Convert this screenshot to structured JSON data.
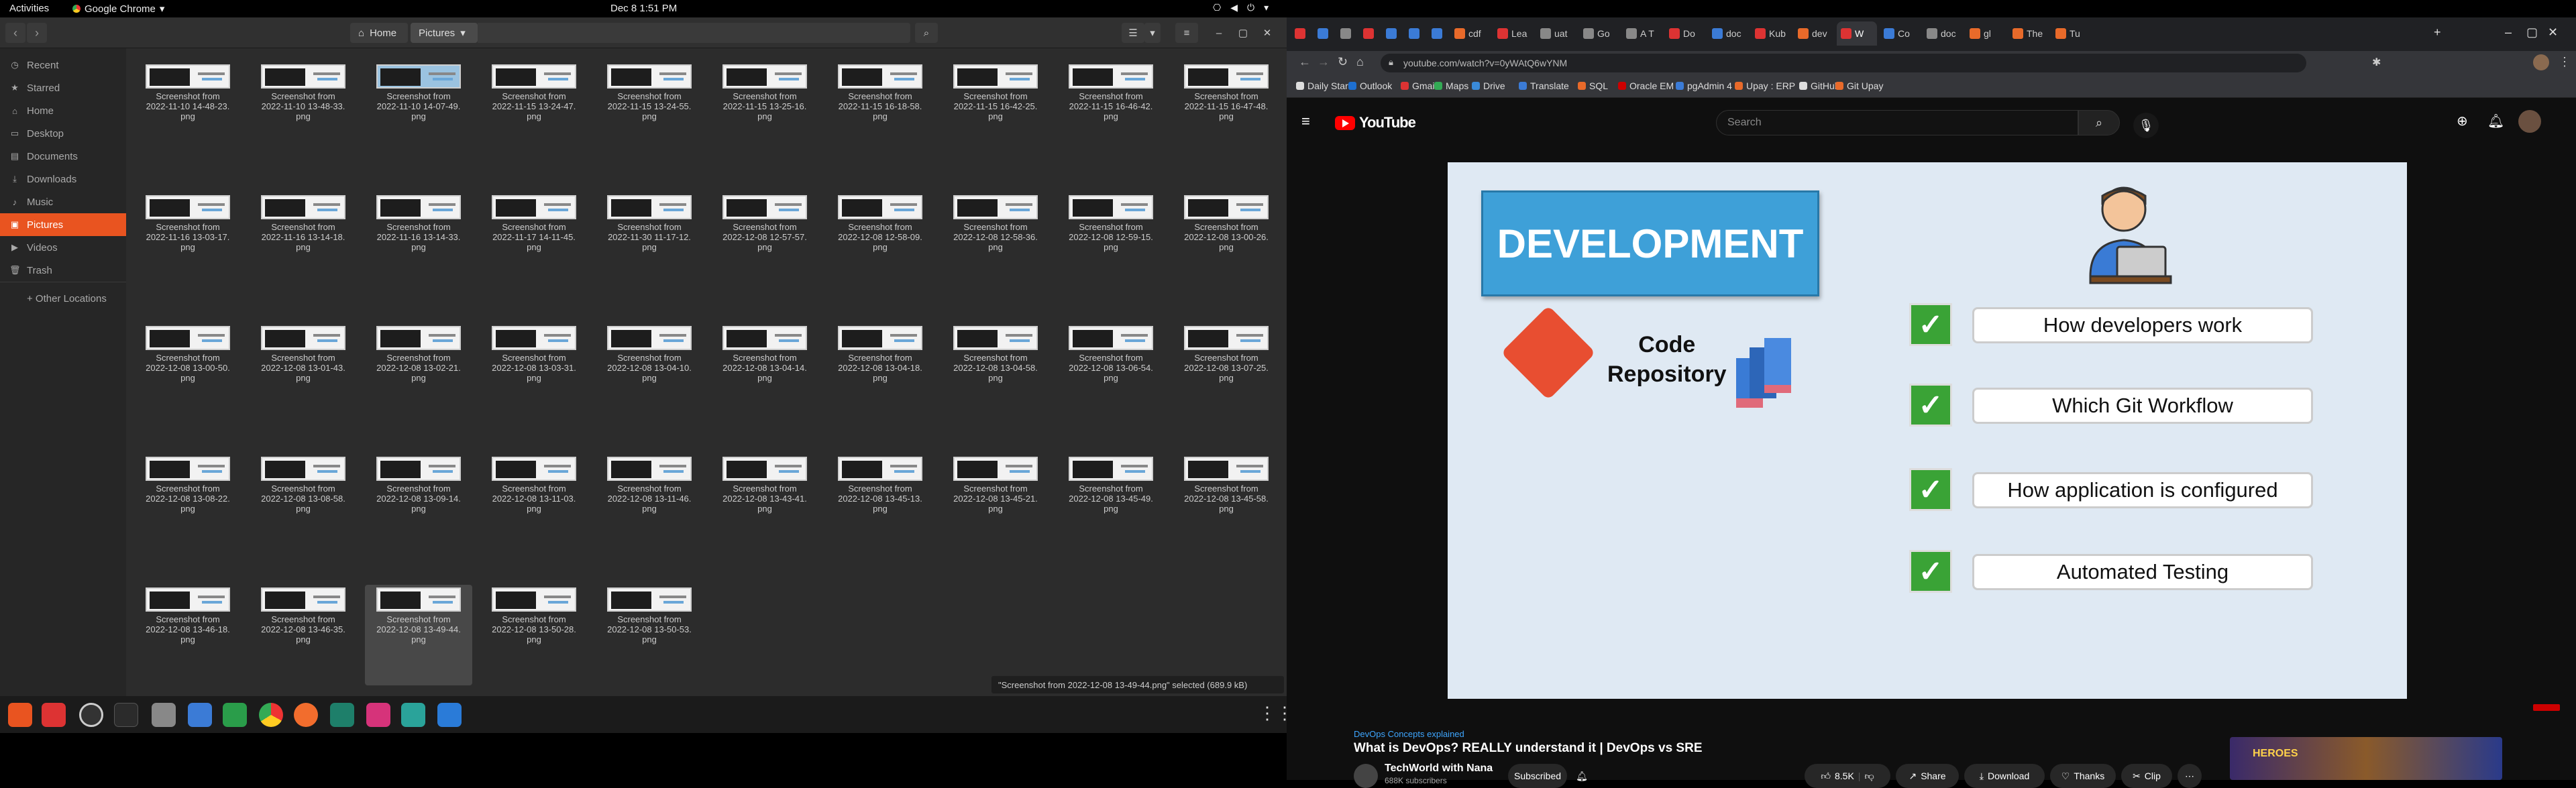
{
  "topbar": {
    "activities": "Activities",
    "app": "Google Chrome",
    "clock": "Dec 8  1:51 PM"
  },
  "files": {
    "crumbs": [
      "Home",
      "Pictures"
    ],
    "sidebar": [
      {
        "label": "Recent",
        "icon": "clock-icon"
      },
      {
        "label": "Starred",
        "icon": "star-icon"
      },
      {
        "label": "Home",
        "icon": "home-icon"
      },
      {
        "label": "Desktop",
        "icon": "desktop-icon"
      },
      {
        "label": "Documents",
        "icon": "documents-icon"
      },
      {
        "label": "Downloads",
        "icon": "downloads-icon"
      },
      {
        "label": "Music",
        "icon": "music-icon"
      },
      {
        "label": "Pictures",
        "icon": "pictures-icon"
      },
      {
        "label": "Videos",
        "icon": "videos-icon"
      },
      {
        "label": "Trash",
        "icon": "trash-icon"
      },
      {
        "label": "+ Other Locations",
        "icon": "plus-icon"
      }
    ],
    "items": [
      [
        "Screenshot from",
        "2022-11-10 14-48-23.",
        "png"
      ],
      [
        "Screenshot from",
        "2022-11-10 13-48-33.",
        "png"
      ],
      [
        "Screenshot from",
        "2022-11-10 14-07-49.",
        "png"
      ],
      [
        "Screenshot from",
        "2022-11-15 13-24-47.",
        "png"
      ],
      [
        "Screenshot from",
        "2022-11-15 13-24-55.",
        "png"
      ],
      [
        "Screenshot from",
        "2022-11-15 13-25-16.",
        "png"
      ],
      [
        "Screenshot from",
        "2022-11-15 16-18-58.",
        "png"
      ],
      [
        "Screenshot from",
        "2022-11-15 16-42-25.",
        "png"
      ],
      [
        "Screenshot from",
        "2022-11-15 16-46-42.",
        "png"
      ],
      [
        "Screenshot from",
        "2022-11-15 16-47-48.",
        "png"
      ],
      [
        "Screenshot from",
        "2022-11-16 13-03-17.",
        "png"
      ],
      [
        "Screenshot from",
        "2022-11-16 13-14-18.",
        "png"
      ],
      [
        "Screenshot from",
        "2022-11-16 13-14-33.",
        "png"
      ],
      [
        "Screenshot from",
        "2022-11-17 14-11-45.",
        "png"
      ],
      [
        "Screenshot from",
        "2022-11-30 11-17-12.",
        "png"
      ],
      [
        "Screenshot from",
        "2022-12-08 12-57-57.",
        "png"
      ],
      [
        "Screenshot from",
        "2022-12-08 12-58-09.",
        "png"
      ],
      [
        "Screenshot from",
        "2022-12-08 12-58-36.",
        "png"
      ],
      [
        "Screenshot from",
        "2022-12-08 12-59-15.",
        "png"
      ],
      [
        "Screenshot from",
        "2022-12-08 13-00-26.",
        "png"
      ],
      [
        "Screenshot from",
        "2022-12-08 13-00-50.",
        "png"
      ],
      [
        "Screenshot from",
        "2022-12-08 13-01-43.",
        "png"
      ],
      [
        "Screenshot from",
        "2022-12-08 13-02-21.",
        "png"
      ],
      [
        "Screenshot from",
        "2022-12-08 13-03-31.",
        "png"
      ],
      [
        "Screenshot from",
        "2022-12-08 13-04-10.",
        "png"
      ],
      [
        "Screenshot from",
        "2022-12-08 13-04-14.",
        "png"
      ],
      [
        "Screenshot from",
        "2022-12-08 13-04-18.",
        "png"
      ],
      [
        "Screenshot from",
        "2022-12-08 13-04-58.",
        "png"
      ],
      [
        "Screenshot from",
        "2022-12-08 13-06-54.",
        "png"
      ],
      [
        "Screenshot from",
        "2022-12-08 13-07-25.",
        "png"
      ],
      [
        "Screenshot from",
        "2022-12-08 13-08-22.",
        "png"
      ],
      [
        "Screenshot from",
        "2022-12-08 13-08-58.",
        "png"
      ],
      [
        "Screenshot from",
        "2022-12-08 13-09-14.",
        "png"
      ],
      [
        "Screenshot from",
        "2022-12-08 13-11-03.",
        "png"
      ],
      [
        "Screenshot from",
        "2022-12-08 13-11-46.",
        "png"
      ],
      [
        "Screenshot from",
        "2022-12-08 13-43-41.",
        "png"
      ],
      [
        "Screenshot from",
        "2022-12-08 13-45-13.",
        "png"
      ],
      [
        "Screenshot from",
        "2022-12-08 13-45-21.",
        "png"
      ],
      [
        "Screenshot from",
        "2022-12-08 13-45-49.",
        "png"
      ],
      [
        "Screenshot from",
        "2022-12-08 13-45-58.",
        "png"
      ],
      [
        "Screenshot from",
        "2022-12-08 13-46-18.",
        "png"
      ],
      [
        "Screenshot from",
        "2022-12-08 13-46-35.",
        "png"
      ],
      [
        "Screenshot from",
        "2022-12-08 13-49-44.",
        "png"
      ],
      [
        "Screenshot from",
        "2022-12-08 13-50-28.",
        "png"
      ],
      [
        "Screenshot from",
        "2022-12-08 13-50-53.",
        "png"
      ]
    ],
    "selected_index": 42,
    "status": "\"Screenshot from 2022-12-08 13-49-44.png\" selected  (689.9 kB)"
  },
  "chrome": {
    "tabs": [
      "",
      "",
      "",
      "",
      "",
      "",
      "",
      "cdf",
      "Lea",
      "uat",
      "Go",
      "A T",
      "Do",
      "doc",
      "Kub",
      "dev",
      "W",
      "Co",
      "doc",
      "gl",
      "The",
      "Tu"
    ],
    "url": "youtube.com/watch?v=0yWAtQ6wYNM",
    "bookmarks": [
      "Daily Star",
      "Outlook",
      "Gmail",
      "Maps",
      "Drive",
      "Translate",
      "SQL",
      "Oracle EM",
      "pgAdmin 4",
      "Upay : ERP",
      "GitHub",
      "Git Upay"
    ]
  },
  "youtube": {
    "logo": "YouTube",
    "search_placeholder": "Search",
    "slide": {
      "title": "DEVELOPMENT",
      "repo_line1": "Code",
      "repo_line2": "Repository",
      "points": [
        "How developers work",
        "Which Git Workflow",
        "How application is configured",
        "Automated Testing"
      ]
    },
    "tagline": "DevOps Concepts explained",
    "title": "What is DevOps? REALLY understand it | DevOps vs SRE",
    "channel": "TechWorld with Nana",
    "subscribers": "688K subscribers",
    "subscribed": "Subscribed",
    "likes": "8.5K",
    "share": "Share",
    "download": "Download",
    "thanks": "Thanks",
    "clip": "Clip",
    "ad_text": "HEROES"
  },
  "colors": {
    "accent": "#e95420",
    "yt_red": "#ff0000",
    "slide_blue": "#3ea0d8",
    "check_green": "#3aa336"
  }
}
